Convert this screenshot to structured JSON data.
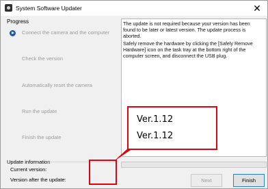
{
  "window": {
    "title": "System Software Updater",
    "close_glyph": "✕"
  },
  "progress": {
    "label": "Progress",
    "steps": [
      {
        "label": "Connect the camera and the computer",
        "active": true
      },
      {
        "label": "Check the version",
        "active": false
      },
      {
        "label": "Automatically reset the camera",
        "active": false
      },
      {
        "label": "Run the update",
        "active": false
      },
      {
        "label": "Finish the update",
        "active": false
      }
    ]
  },
  "message": {
    "line1": "The update is not required because your version has been found to be later or latest version. The update process is aborted.",
    "line2": "Safely remove the hardware by clicking the [Safely Remove Hardware] icon on the task tray at the bottom right of the computer screen, and disconnect the USB plug."
  },
  "update_info": {
    "label": "Update information",
    "current_version_label": "Current version:",
    "after_update_label": "Version after the update:"
  },
  "buttons": {
    "next": "Next",
    "finish": "Finish"
  },
  "annotation": {
    "current_version": "Ver.1.12",
    "after_version": "Ver.1.12"
  },
  "colors": {
    "annotation_red": "#e3000f",
    "active_step_icon": "#1c5aa6"
  }
}
